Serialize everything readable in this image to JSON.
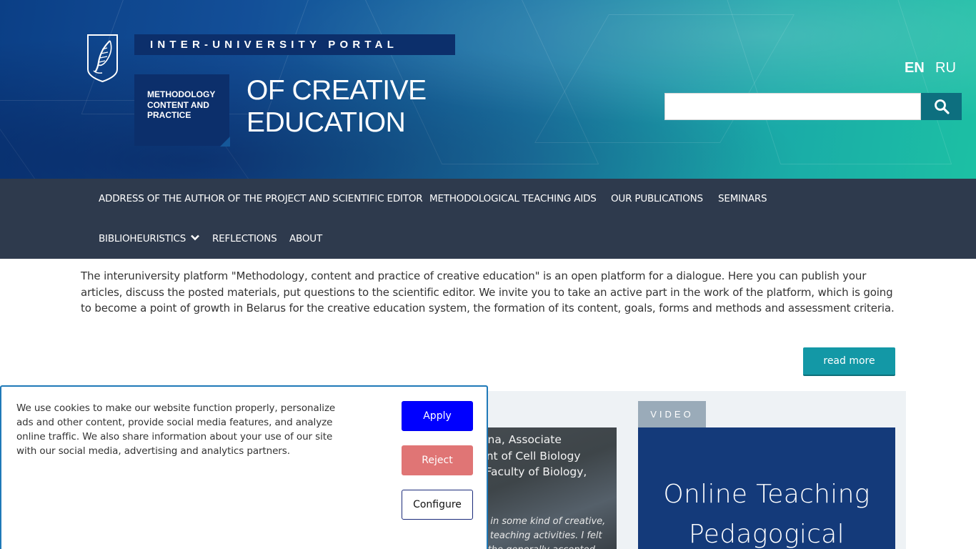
{
  "header": {
    "portal_label": "INTER-UNIVERSITY  PORTAL",
    "sub_label_lines": [
      "METHODOLOGY",
      "CONTENT AND",
      "PRACTICE"
    ],
    "title_lines": [
      "OF CREATIVE",
      "EDUCATION"
    ],
    "languages": [
      "EN",
      "RU"
    ],
    "active_language": "EN",
    "search": {
      "value": "",
      "placeholder": ""
    }
  },
  "nav": {
    "items": [
      "ADDRESS OF THE AUTHOR OF THE PROJECT AND SCIENTIFIC EDITOR",
      "METHODOLOGICAL TEACHING AIDS",
      "OUR PUBLICATIONS",
      "SEMINARS",
      "BIBLIOHEURISTICS",
      "REFLECTIONS",
      "ABOUT"
    ]
  },
  "intro": {
    "text": "The interuniversity platform \"Methodology, content and practice of creative education\" is an open platform for a dialogue. Here you can publish your articles, discuss the posted materials, put questions to the scientific editor. We invite you to take an active part in the work of the platform, which is going to become a point of growth in Belarus for the creative education system, the formation of its content, goals, forms and methods and assessment criteria.",
    "read_more": "read more"
  },
  "article": {
    "title_lines": [
      "laevna, Associate",
      "tment of Cell Biology",
      "ng, Faculty of Biology,"
    ],
    "quote_lines": [
      "g in some kind of creative,",
      "y teaching activities. I felt",
      "f the generally accepted"
    ]
  },
  "video": {
    "tag": "VIDEO",
    "title_lines": [
      "Online Teaching",
      "Pedagogical"
    ]
  },
  "cookie": {
    "text": "We use cookies to make our website function properly, personalize ads and other content, provide social media features, and analyze online traffic. We also share information about your use of our site with our social media, advertising and analytics partners.",
    "apply": "Apply",
    "reject": "Reject",
    "configure": "Configure"
  },
  "colors": {
    "nav_bg": "#2e3a4d",
    "accent_teal": "#1398a6",
    "apply_blue": "#0000ff",
    "reject_red": "#e07575",
    "video_bg": "#143a7a"
  }
}
